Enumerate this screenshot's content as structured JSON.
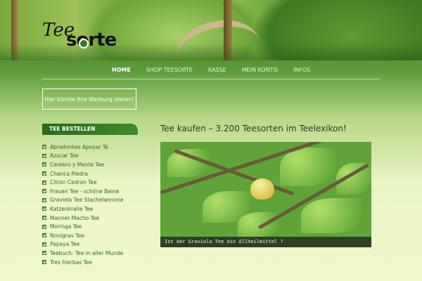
{
  "logo": {
    "part1": "Tee",
    "part2": "sorte"
  },
  "nav": {
    "items": [
      {
        "label": "HOME",
        "active": true
      },
      {
        "label": "SHOP TEESORTE",
        "active": false
      },
      {
        "label": "KASSE",
        "active": false
      },
      {
        "label": "MEIN KONTO",
        "active": false
      },
      {
        "label": "INFOS",
        "active": false
      }
    ]
  },
  "ad": {
    "text": "Hier könnte Ihre Werbung stehen!"
  },
  "sidebar": {
    "title": "TEE BESTELLEN",
    "items": [
      "Abnehmtee Apoyar Té",
      "Azucar Tee",
      "Cerebro y Mente Tee",
      "Chanca Piedra",
      "Citron Cedron Tee",
      "Frauen Tee - schöne Beine",
      "Graviola Tee Stachelannone",
      "Katzenkralle Tee",
      "Manner Macho Tee",
      "Moringa Tee",
      "Nonigrav Tee",
      "Papaya Tee",
      "Teebuch: Tee in aller Munde",
      "Tres hierbas Tee"
    ]
  },
  "main": {
    "title": "Tee kaufen – 3.200 Teesorten im Teelexikon!",
    "slider_caption": "Ist der Graviola Tee ein Allheilmittel ?"
  },
  "colors": {
    "nav_text": "#e8f4d8",
    "sidebar_link": "#2f6a20",
    "sidebar_head": "#2a6a1e"
  }
}
